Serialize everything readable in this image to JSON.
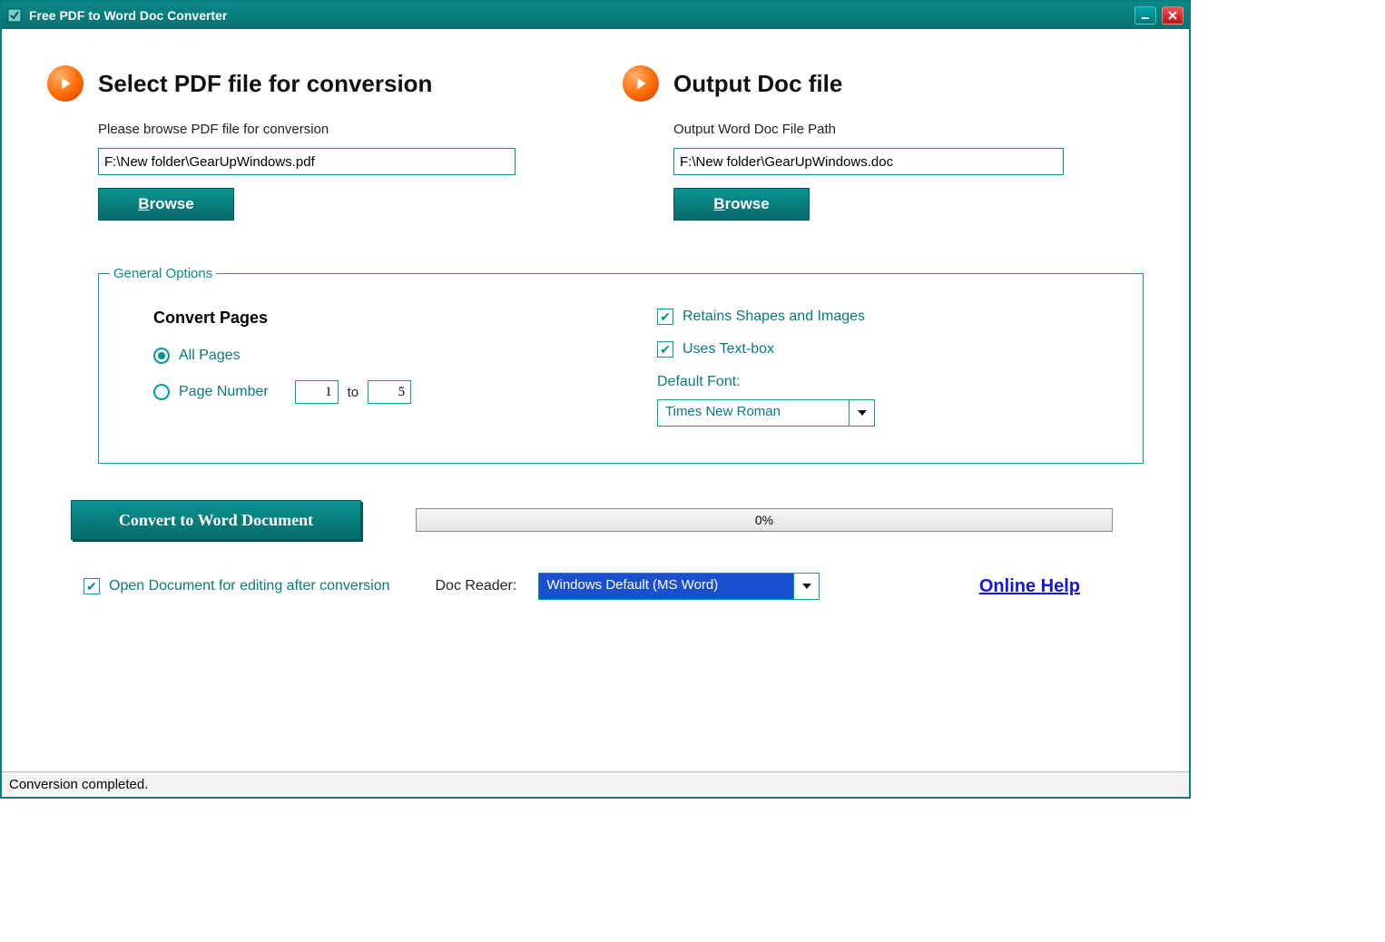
{
  "window": {
    "title": "Free PDF to Word Doc Converter"
  },
  "input_section": {
    "heading": "Select PDF file for conversion",
    "label": "Please browse PDF file for conversion",
    "path": "F:\\New folder\\GearUpWindows.pdf",
    "browse": "Browse"
  },
  "output_section": {
    "heading": "Output Doc file",
    "label": "Output Word Doc File Path",
    "path": "F:\\New folder\\GearUpWindows.doc",
    "browse": "Browse"
  },
  "general": {
    "legend": "General Options",
    "convert_pages_title": "Convert Pages",
    "all_pages": "All Pages",
    "page_number": "Page Number",
    "page_from": "1",
    "to": "to",
    "page_to": "5",
    "retains": "Retains Shapes and Images",
    "textbox": "Uses Text-box",
    "default_font_label": "Default Font:",
    "default_font": "Times New Roman"
  },
  "action": {
    "convert": "Convert to Word Document",
    "progress": "0%"
  },
  "bottom": {
    "open_after": "Open Document for editing after conversion",
    "reader_label": "Doc Reader:",
    "reader_value": "Windows Default (MS Word)",
    "help": "Online Help"
  },
  "status": "Conversion completed."
}
